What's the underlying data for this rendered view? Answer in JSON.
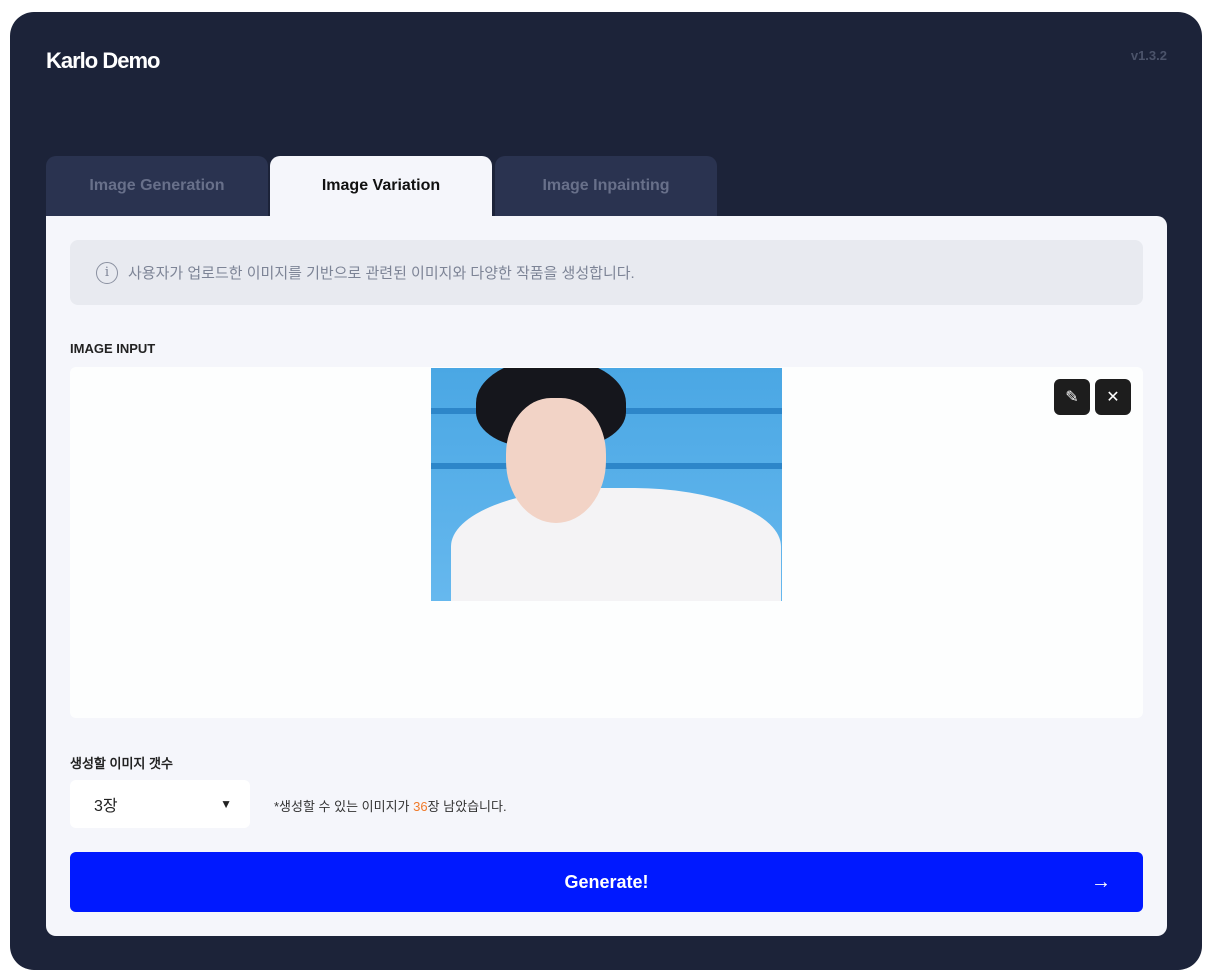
{
  "header": {
    "title": "Karlo Demo",
    "version": "v1.3.2"
  },
  "tabs": [
    {
      "label": "Image Generation",
      "active": false
    },
    {
      "label": "Image Variation",
      "active": true
    },
    {
      "label": "Image Inpainting",
      "active": false
    }
  ],
  "info": {
    "icon": "info-icon",
    "text": "사용자가 업로드한 이미지를 기반으로 관련된 이미지와 다양한 작품을 생성합니다."
  },
  "image_input": {
    "label": "IMAGE INPUT",
    "edit_icon": "pencil-icon",
    "remove_icon": "close-icon"
  },
  "count": {
    "label": "생성할 이미지 갯수",
    "selected": "3장",
    "note_prefix": "*생성할 수 있는 이미지가 ",
    "remaining": "36",
    "note_suffix": "장 남았습니다.",
    "highlight_color": "#f07a2a"
  },
  "generate": {
    "label": "Generate!",
    "color": "#0019ff"
  }
}
